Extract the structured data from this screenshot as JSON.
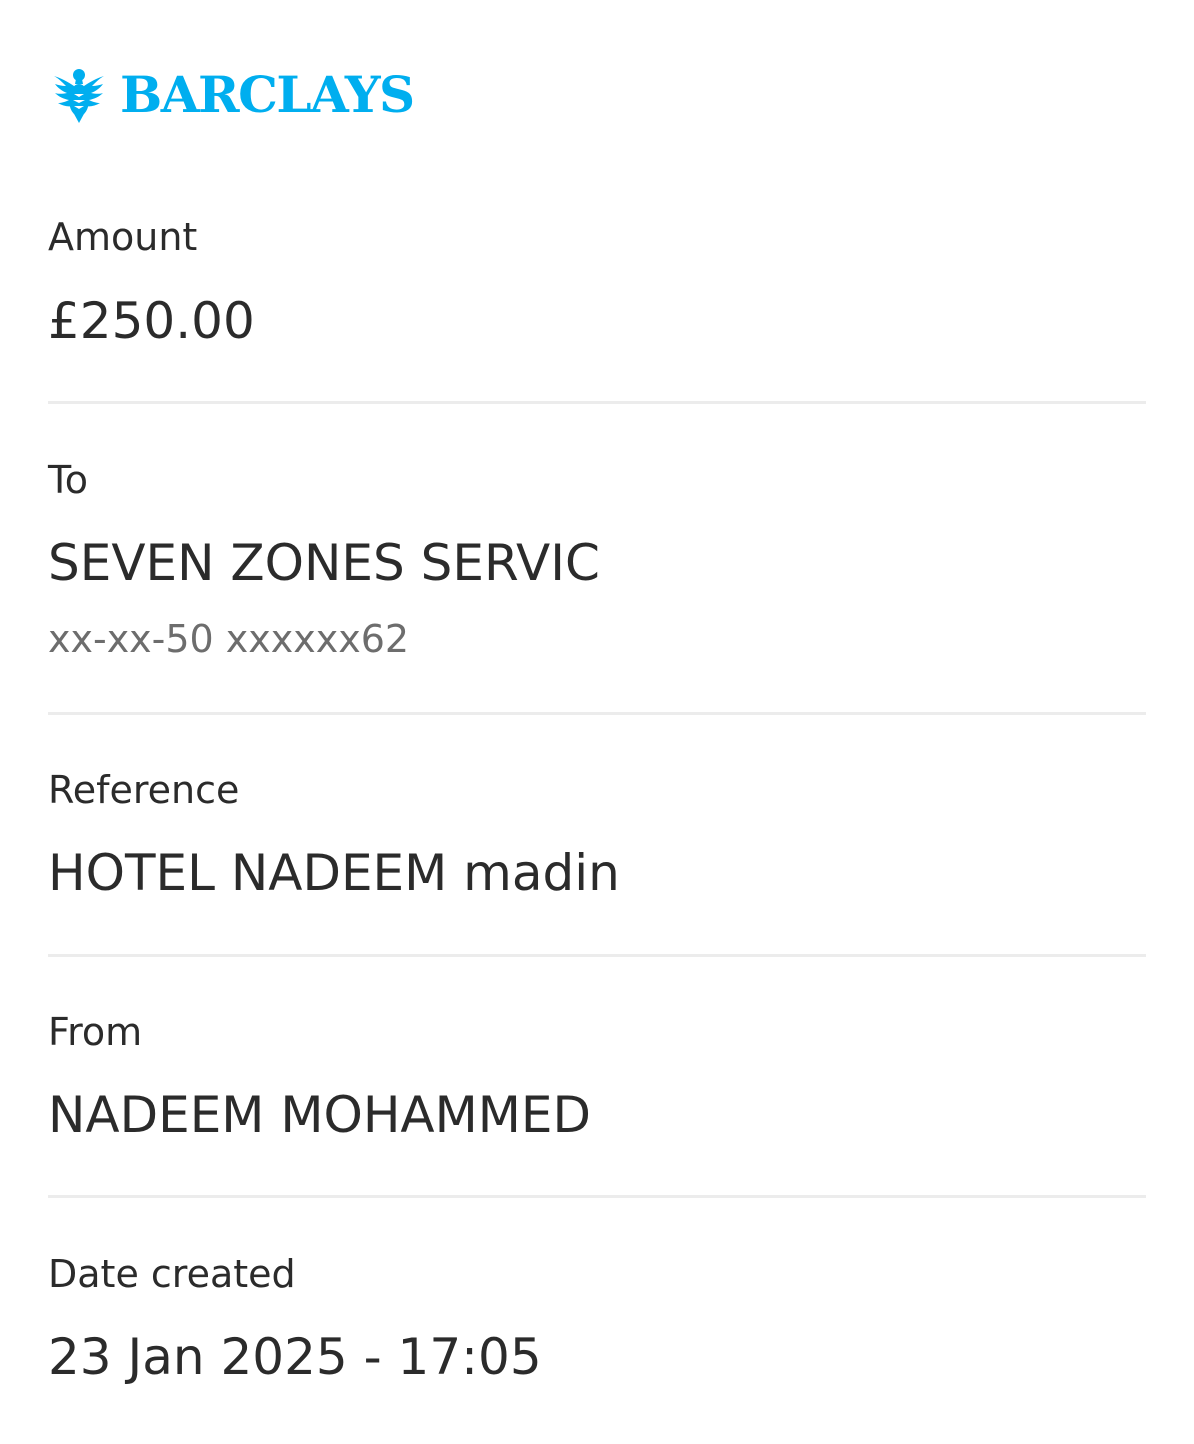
{
  "brand": {
    "name": "BARCLAYS",
    "color": "#00aeef",
    "icon": "eagle-icon"
  },
  "payment": {
    "amount_label": "Amount",
    "amount_value": "£250.00",
    "to_label": "To",
    "to_value": "SEVEN ZONES SERVIC",
    "to_account": "xx-xx-50 xxxxxx62",
    "reference_label": "Reference",
    "reference_value": "HOTEL NADEEM madin",
    "from_label": "From",
    "from_value": "NADEEM MOHAMMED",
    "date_label": "Date created",
    "date_value": "23 Jan 2025 - 17:05"
  },
  "colors": {
    "text": "#2b2b2b",
    "muted": "#6d6d6d",
    "divider": "#ececec"
  }
}
